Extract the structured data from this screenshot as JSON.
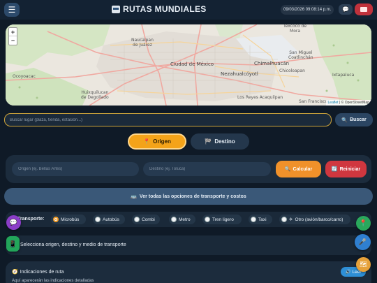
{
  "header": {
    "title": "RUTAS MUNDIALES",
    "datetime": "09/03/2026 09:08:14 p.m.",
    "menu_icon": "hamburger-icon",
    "chat_icon": "chat-icon",
    "mail_icon": "envelope-icon"
  },
  "map": {
    "zoom_in": "+",
    "zoom_out": "−",
    "labels": {
      "naucalpan": "Naucalpan\nde Juárez",
      "ciudad": "Ciudad de México",
      "nezahualcoyotl": "Nezahualcóyotl",
      "chimalhuacan": "Chimalhuacán",
      "huixquilucan": "Huixquilucan\nde Degollado",
      "texcoco": "Texcoco de\nMora",
      "san_miguel": "San Miguel\nCoatlinchán",
      "chicoloapan": "Chicoloapan",
      "la_paz": "Los Reyes Acaquilpan",
      "san_francisco": "San Francisco",
      "ocoyoacac": "Ocoyoacac",
      "ixtapaluca": "Ixtapaluca"
    },
    "attribution_leaflet": "Leaflet",
    "attribution_osm": "| © OpenStreetMap"
  },
  "search": {
    "placeholder": "Buscar lugar (plaza, tienda, estación...)",
    "button": "Buscar"
  },
  "tabs": {
    "origin": "Origen",
    "destination": "Destino"
  },
  "route": {
    "origin_placeholder": "Origen (ej. Bellas Artes)",
    "dest_placeholder": "Destino (ej. Toluca)",
    "calculate": "Calcular",
    "reset": "Reiniciar"
  },
  "options": {
    "label": "Ver todas las opciones de transporte y costos"
  },
  "transport": {
    "label": "Transporte:",
    "selected": "Microbús",
    "options": [
      "Microbús",
      "Autobús",
      "Combi",
      "Metro",
      "Tren ligero",
      "Taxi",
      "Otro (avión/barco/carro)"
    ]
  },
  "status": {
    "text": "Selecciona origen, destino y medio de transporte"
  },
  "directions": {
    "title": "Indicaciones de ruta",
    "empty": "Aquí aparecerán las indicaciones detalladas",
    "read_button": "Leer"
  },
  "colors": {
    "accent": "#f4a319",
    "danger": "#d0373f",
    "primary": "#2e8fd6",
    "background": "#0f1a27"
  }
}
